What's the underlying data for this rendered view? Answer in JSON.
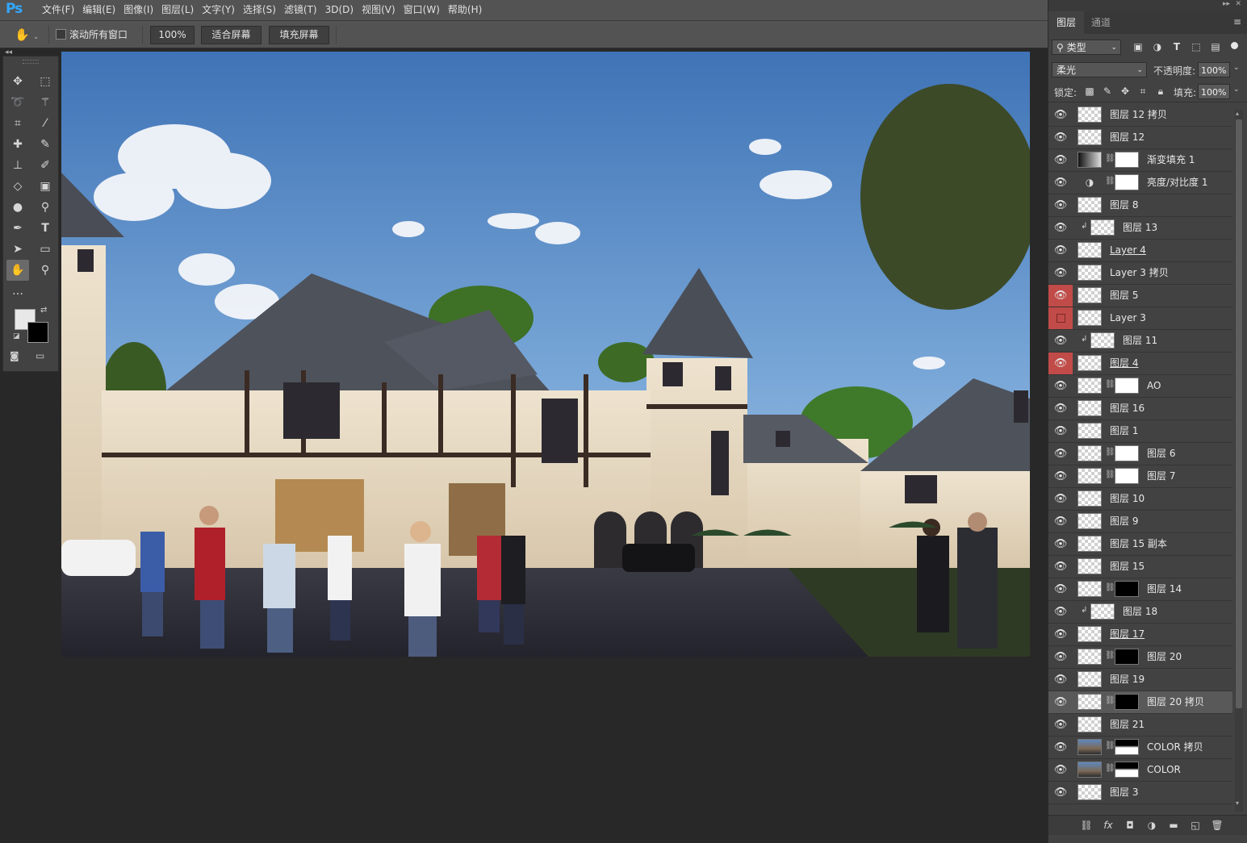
{
  "app": {
    "logo": "Ps"
  },
  "menu": [
    "文件(F)",
    "编辑(E)",
    "图像(I)",
    "图层(L)",
    "文字(Y)",
    "选择(S)",
    "滤镜(T)",
    "3D(D)",
    "视图(V)",
    "窗口(W)",
    "帮助(H)"
  ],
  "options": {
    "scroll_all_label": "滚动所有窗口",
    "scroll_all_checked": false,
    "zoom_value": "100%",
    "fit_screen_label": "适合屏幕",
    "fill_screen_label": "填充屏幕"
  },
  "tools": [
    "move-icon",
    "marquee-icon",
    "lasso-icon",
    "magic-wand-icon",
    "crop-icon",
    "eyedropper-icon",
    "healing-brush-icon",
    "brush-icon",
    "stamp-icon",
    "history-brush-icon",
    "eraser-icon",
    "gradient-icon",
    "blur-icon",
    "dodge-icon",
    "pen-icon",
    "type-icon",
    "path-select-icon",
    "rectangle-icon",
    "hand-icon",
    "zoom-icon"
  ],
  "active_tool": "hand-icon",
  "panel": {
    "tabs": [
      "图层",
      "通道"
    ],
    "filter_kind": "类型",
    "blend_mode": "柔光",
    "opacity_label": "不透明度:",
    "opacity_value": "100%",
    "lock_label": "锁定:",
    "fill_label": "填充:",
    "fill_value": "100%"
  },
  "layers": [
    {
      "name": "图层 12 拷贝",
      "eye": "visible"
    },
    {
      "name": "图层 12",
      "eye": "visible"
    },
    {
      "name": "渐变填充 1",
      "eye": "visible",
      "kind": "gradient",
      "mask": true
    },
    {
      "name": "亮度/对比度 1",
      "eye": "visible",
      "kind": "adjust",
      "mask": true
    },
    {
      "name": "图层 8",
      "eye": "visible"
    },
    {
      "name": "图层 13",
      "eye": "visible",
      "clipped": true
    },
    {
      "name": "Layer 4",
      "eye": "visible",
      "underline": true
    },
    {
      "name": "Layer 3 拷贝",
      "eye": "visible"
    },
    {
      "name": "图层 5",
      "eye": "red"
    },
    {
      "name": "Layer 3",
      "eye": "red-hidden"
    },
    {
      "name": "图层 11",
      "eye": "visible",
      "clipped": true
    },
    {
      "name": "图层 4",
      "eye": "red",
      "underline": true
    },
    {
      "name": "AO",
      "eye": "visible",
      "mask": true
    },
    {
      "name": "图层 16",
      "eye": "visible"
    },
    {
      "name": "图层 1",
      "eye": "visible"
    },
    {
      "name": "图层 6",
      "eye": "visible",
      "mask": true
    },
    {
      "name": "图层 7",
      "eye": "visible",
      "mask": true
    },
    {
      "name": "图层 10",
      "eye": "visible"
    },
    {
      "name": "图层 9",
      "eye": "visible"
    },
    {
      "name": "图层 15 副本",
      "eye": "visible"
    },
    {
      "name": "图层 15",
      "eye": "visible"
    },
    {
      "name": "图层 14",
      "eye": "visible",
      "mask": true,
      "mask_dark": true
    },
    {
      "name": "图层 18",
      "eye": "visible",
      "clipped": true
    },
    {
      "name": "图层 17",
      "eye": "visible",
      "underline": true
    },
    {
      "name": "图层 20",
      "eye": "visible",
      "mask": true,
      "mask_dark": true
    },
    {
      "name": "图层 19",
      "eye": "visible"
    },
    {
      "name": "图层 20 拷贝",
      "eye": "visible",
      "mask": true,
      "mask_dark": true,
      "selected": true
    },
    {
      "name": "图层 21",
      "eye": "visible"
    },
    {
      "name": "COLOR 拷贝",
      "eye": "visible",
      "mask": true,
      "photo": true
    },
    {
      "name": "COLOR",
      "eye": "visible",
      "mask": true,
      "photo": true
    },
    {
      "name": "图层 3",
      "eye": "visible"
    }
  ],
  "bottom_icons": [
    "link-icon",
    "fx-icon",
    "add-mask-icon",
    "adjustment-icon",
    "group-icon",
    "new-layer-icon",
    "delete-icon"
  ]
}
